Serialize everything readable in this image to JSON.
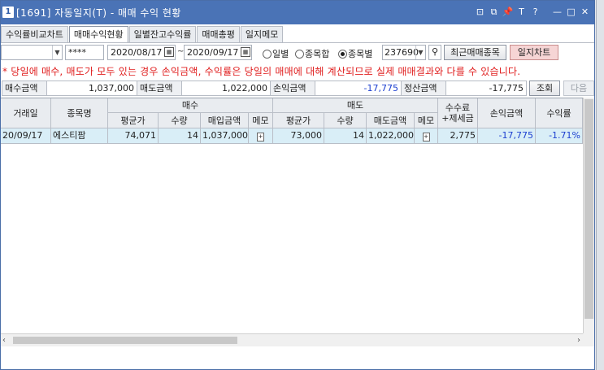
{
  "window": {
    "icon_label": "1",
    "title": "[1691] 자동일지(T) - 매매 수익 현황",
    "buttons": [
      "⊡",
      "⧉",
      "📌",
      "T",
      "?",
      "—",
      "□",
      "✕"
    ]
  },
  "tabs": [
    {
      "label": "수익률비교차트",
      "active": false
    },
    {
      "label": "매매수익현황",
      "active": true
    },
    {
      "label": "일별잔고수익률",
      "active": false
    },
    {
      "label": "매매총평",
      "active": false
    },
    {
      "label": "일지메모",
      "active": false
    }
  ],
  "toolbar": {
    "password": "****",
    "date_from": "2020/08/17",
    "date_to": "2020/09/17",
    "tilde": "~",
    "radio_daily": "일별",
    "radio_by_stock_sum": "종목합",
    "radio_by_stock": "종목별",
    "stock_code": "237690",
    "recent_trades_button": "최근매매종목",
    "journal_chart_button": "일지차트"
  },
  "notice": "* 당일에 매수, 매도가 모두 있는 경우 손익금액, 수익률은 당일의 매매에 대해 계산되므로 실제 매매결과와 다를 수 있습니다.",
  "summary": {
    "buy_amount_label": "매수금액",
    "buy_amount": "1,037,000",
    "sell_amount_label": "매도금액",
    "sell_amount": "1,022,000",
    "pnl_label": "손익금액",
    "pnl": "-17,775",
    "settle_label": "정산금액",
    "settle": "-17,775",
    "query_button": "조회",
    "next_button": "다음"
  },
  "grid": {
    "headers": {
      "trade_date": "거래일",
      "stock_name": "종목명",
      "buy_group": "매수",
      "sell_group": "매도",
      "fee_tax": "수수료\n+제세금",
      "pnl": "손익금액",
      "return_rate": "수익률",
      "buy_avg": "평균가",
      "buy_qty": "수량",
      "buy_amount": "매입금액",
      "buy_memo": "메모",
      "sell_avg": "평균가",
      "sell_qty": "수량",
      "sell_amount": "매도금액",
      "sell_memo": "메모"
    },
    "rows": [
      {
        "trade_date": "20/09/17",
        "stock_name": "에스티팜",
        "buy_avg": "74,071",
        "buy_qty": "14",
        "buy_amount": "1,037,000",
        "sell_avg": "73,000",
        "sell_qty": "14",
        "sell_amount": "1,022,000",
        "fee_tax": "2,775",
        "pnl": "-17,775",
        "return_rate": "-1.71%"
      }
    ]
  },
  "colors": {
    "titlebar": "#4a73b6",
    "notice": "#e01e1e",
    "negative": "#1c3fd0",
    "row_highlight": "#d9eef7"
  }
}
